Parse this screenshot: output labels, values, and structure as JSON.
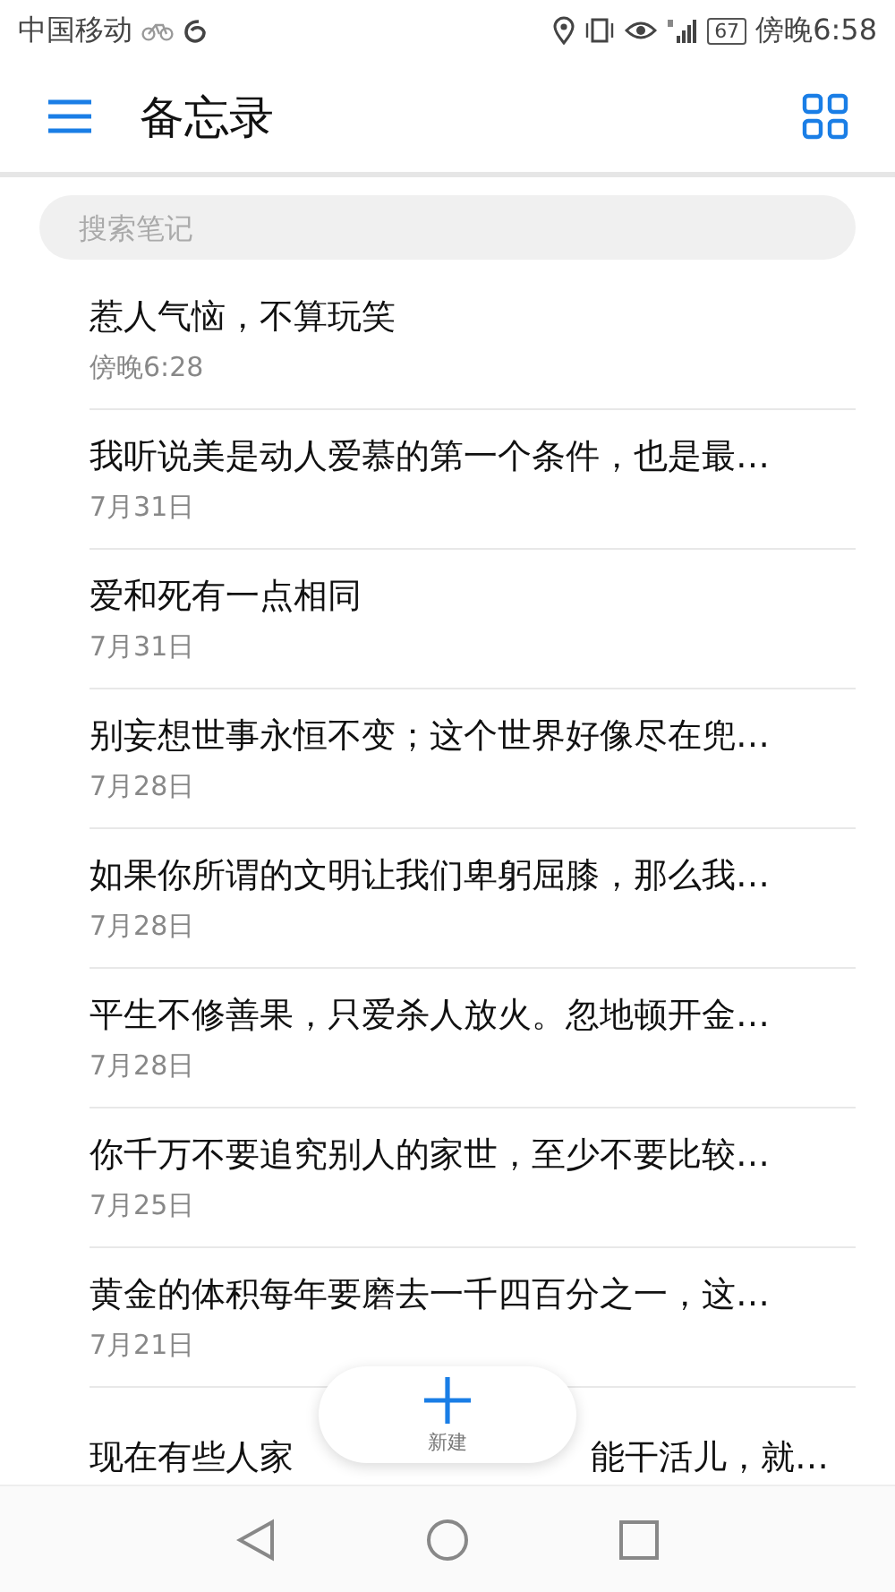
{
  "status_bar": {
    "carrier": "中国移动",
    "battery": "67",
    "time": "傍晚6:58"
  },
  "header": {
    "title": "备忘录"
  },
  "search": {
    "placeholder": "搜索笔记"
  },
  "notes": [
    {
      "title_parts": [
        "惹人气恼，不算玩笑"
      ],
      "date": "傍晚6:28"
    },
    {
      "title_parts": [
        "我听说美是动人爱慕的第一个条件，也是最…"
      ],
      "date": "7月31日"
    },
    {
      "title_parts": [
        "爱和死有一点相同"
      ],
      "date": "7月31日"
    },
    {
      "title_parts": [
        "别妄想世事永恒不变；这个世界好像尽在兜…"
      ],
      "date": "7月28日"
    },
    {
      "title_parts": [
        "如果你所谓的文明让我们卑躬屈膝，那么我…"
      ],
      "date": "7月28日"
    },
    {
      "title_parts": [
        "平生不修善果，只爱杀人放火。忽地顿开金…"
      ],
      "date": "7月28日"
    },
    {
      "title_parts": [
        "你千万不要追究别人的家世，至少不要比较…"
      ],
      "date": "7月25日"
    },
    {
      "title_parts": [
        "黄金的体积每年要磨去一千四百分之一，这…"
      ],
      "date": "7月21日"
    },
    {
      "title_parts": [
        "现在有些人家",
        "能干活儿，就…"
      ]
    }
  ],
  "new_button": {
    "label": "新建"
  }
}
